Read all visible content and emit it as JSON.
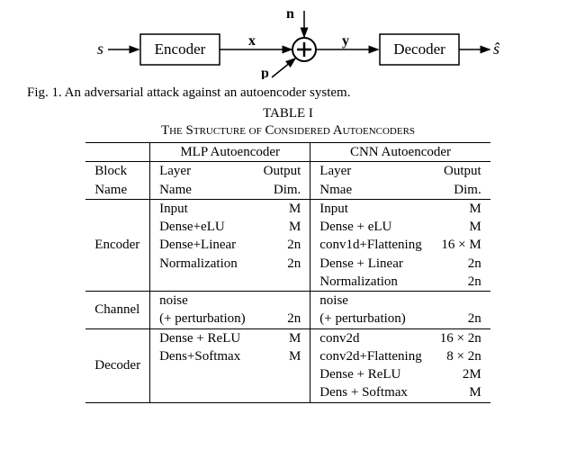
{
  "figure": {
    "s_in": "s",
    "encoder": "Encoder",
    "x": "x",
    "n": "n",
    "p": "p",
    "y": "y",
    "decoder": "Decoder",
    "s_out": "ŝ",
    "caption": "Fig. 1.   An adversarial attack against an autoencoder system."
  },
  "table": {
    "number": "TABLE I",
    "title": "The Structure of Considered Autoencoders",
    "col_mlp": "MLP Autoencoder",
    "col_cnn": "CNN Autoencoder",
    "h_block": "Block",
    "h_name": "Name",
    "h_layer": "Layer",
    "h_layername": "Name",
    "h_nmae": "Nmae",
    "h_output": "Output",
    "h_dim": "Dim.",
    "blocks": {
      "encoder": "Encoder",
      "channel": "Channel",
      "decoder": "Decoder"
    },
    "mlp": {
      "enc": [
        {
          "layer": "Input",
          "out": "M"
        },
        {
          "layer": "Dense+eLU",
          "out": "M"
        },
        {
          "layer": "Dense+Linear",
          "out": "2n"
        },
        {
          "layer": "Normalization",
          "out": "2n"
        }
      ],
      "chan": [
        {
          "layer": "noise",
          "out": ""
        },
        {
          "layer": "(+ perturbation)",
          "out": "2n"
        }
      ],
      "dec": [
        {
          "layer": "Dense + ReLU",
          "out": "M"
        },
        {
          "layer": "Dens+Softmax",
          "out": "M"
        }
      ]
    },
    "cnn": {
      "enc": [
        {
          "layer": "Input",
          "out": "M"
        },
        {
          "layer": "Dense + eLU",
          "out": "M"
        },
        {
          "layer": "conv1d+Flattening",
          "out": "16 × M"
        },
        {
          "layer": "Dense + Linear",
          "out": "2n"
        },
        {
          "layer": "Normalization",
          "out": "2n"
        }
      ],
      "chan": [
        {
          "layer": "noise",
          "out": ""
        },
        {
          "layer": "(+ perturbation)",
          "out": "2n"
        }
      ],
      "dec": [
        {
          "layer": "conv2d",
          "out": "16 × 2n"
        },
        {
          "layer": "conv2d+Flattening",
          "out": "8 × 2n"
        },
        {
          "layer": "Dense + ReLU",
          "out": "2M"
        },
        {
          "layer": "Dens + Softmax",
          "out": "M"
        }
      ]
    }
  }
}
